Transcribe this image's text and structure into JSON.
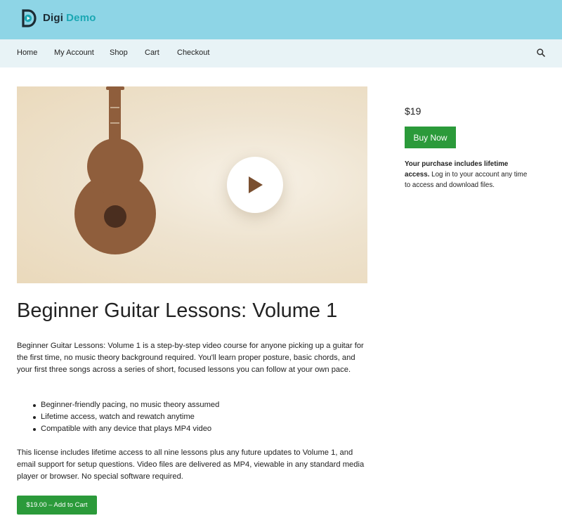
{
  "header": {
    "brand_part1": "Digi",
    "brand_part2": "Demo",
    "logo_icon": "d-play-logo-icon",
    "bg_color": "#8ed5e6",
    "accent_color": "#1aa7b3"
  },
  "nav": {
    "items": [
      {
        "label": "Home"
      },
      {
        "label": "My Account"
      },
      {
        "label": "Shop"
      },
      {
        "label": "Cart"
      },
      {
        "label": "Checkout"
      }
    ],
    "search_icon": "search-icon"
  },
  "product": {
    "title": "Beginner Guitar Lessons: Volume 1",
    "image_icon": "guitar-illustration",
    "play_icon": "play-icon",
    "description": "Beginner Guitar Lessons: Volume 1 is a step-by-step video course for anyone picking up a guitar for the first time, no music theory background required. You'll learn proper posture, basic chords, and your first three songs across a series of short, focused lessons you can follow at your own pace.",
    "features": [
      "Beginner-friendly pacing, no music theory assumed",
      "Lifetime access, watch and rewatch anytime",
      "Compatible with any device that plays MP4 video"
    ],
    "license": "This license includes lifetime access to all nine lessons plus any future updates to Volume 1, and email support for setup questions. Video files are delivered as MP4, viewable in any standard media player or browser. No special software required.",
    "add_to_cart_label": "$19.00 – Add to Cart"
  },
  "sidebar": {
    "price": "$19",
    "buy_label": "Buy Now",
    "note_bold": "Your purchase includes lifetime access.",
    "note_rest": " Log in to your account any time to access and download files.",
    "button_color": "#2b9a3a"
  }
}
